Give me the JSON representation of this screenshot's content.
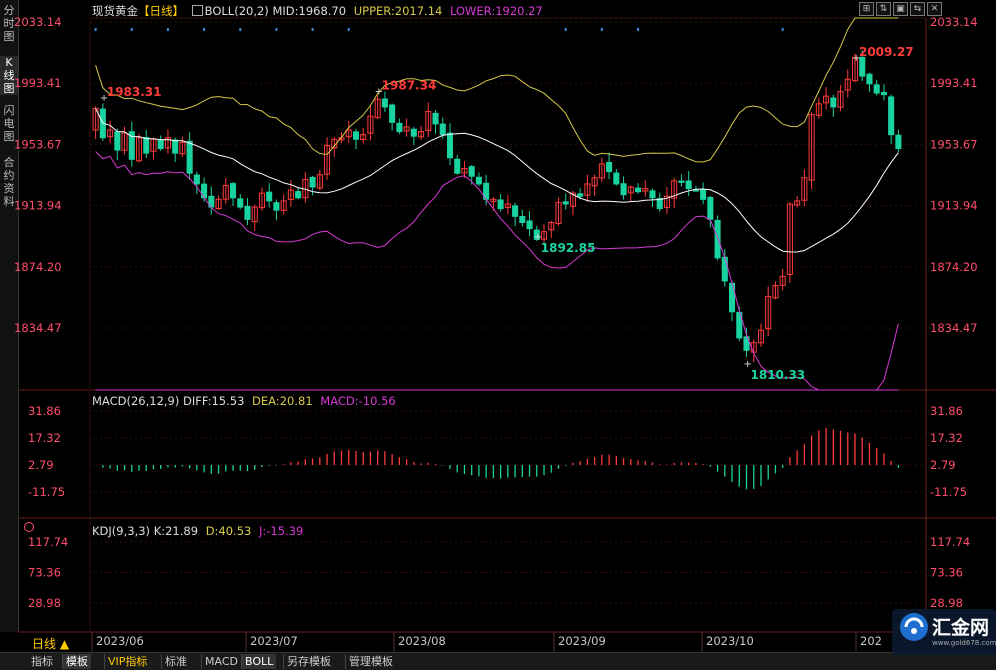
{
  "sidebar": [
    {
      "label": "分时图"
    },
    {
      "label": "K线图"
    },
    {
      "label": "闪电图"
    },
    {
      "label": "合约资料"
    }
  ],
  "header": {
    "instrument": "现货黄金",
    "period": "【日线】",
    "boll_label": "BOLL(20,2)",
    "mid": "MID:1968.70",
    "upper": "UPPER:2017.14",
    "lower": "LOWER:1920.27"
  },
  "macd": {
    "label": "MACD(26,12,9)",
    "diff": "DIFF:15.53",
    "dea": "DEA:20.81",
    "macd": "MACD:-10.56"
  },
  "kdj": {
    "label": "KDJ(9,3,3)",
    "k": "K:21.89",
    "d": "D:40.53",
    "j": "J:-15.39"
  },
  "window_buttons": [
    "⊞",
    "⇅",
    "▣",
    "⇆",
    "✕"
  ],
  "price_axis": [
    "2033.14",
    "1993.41",
    "1953.67",
    "1913.94",
    "1874.20",
    "1834.47"
  ],
  "macd_axis": [
    "31.86",
    "17.32",
    "2.79",
    "-11.75"
  ],
  "kdj_axis": [
    "117.74",
    "73.36",
    "28.98"
  ],
  "date_axis": [
    "2023/06",
    "2023/07",
    "2023/08",
    "2023/09",
    "2023/10",
    "202"
  ],
  "period_button": "日线",
  "annotations": [
    {
      "label": "1983.31"
    },
    {
      "label": "1987.34"
    },
    {
      "label": "1892.85"
    },
    {
      "label": "1810.33"
    },
    {
      "label": "2009.27"
    }
  ],
  "bottom_tabs": [
    "指标",
    "模板",
    "VIP指标",
    "标准",
    "MACD",
    "BOLL",
    "另存模板",
    "管理模板"
  ],
  "logo": {
    "text": "汇金网",
    "url": "www.gold678.com"
  },
  "colors": {
    "up": "#ff3b3b",
    "down": "#19d3a0",
    "mid": "#ffffff",
    "upper": "#d7c94a",
    "lower": "#d63ad6",
    "axis_text": "#ff4d6b"
  },
  "chart_data": [
    {
      "type": "candlestick",
      "title": "现货黄金 日线",
      "x_ticks": [
        "2023/06",
        "2023/07",
        "2023/08",
        "2023/09",
        "2023/10"
      ],
      "ylim": [
        1810,
        2045
      ],
      "close": [
        1977,
        1958,
        1963,
        1950,
        1961,
        1944,
        1958,
        1948,
        1957,
        1951,
        1958,
        1948,
        1955,
        1935,
        1928,
        1919,
        1913,
        1918,
        1927,
        1919,
        1913,
        1905,
        1913,
        1922,
        1917,
        1911,
        1917,
        1924,
        1919,
        1931,
        1926,
        1934,
        1953,
        1957,
        1958,
        1963,
        1957,
        1960,
        1972,
        1983,
        1978,
        1968,
        1962,
        1965,
        1959,
        1962,
        1975,
        1967,
        1960,
        1945,
        1935,
        1938,
        1933,
        1928,
        1918,
        1918,
        1912,
        1915,
        1907,
        1903,
        1899,
        1892,
        1897,
        1903,
        1916,
        1915,
        1922,
        1920,
        1928,
        1932,
        1941,
        1936,
        1928,
        1921,
        1926,
        1923,
        1925,
        1919,
        1912,
        1920,
        1930,
        1929,
        1925,
        1924,
        1918,
        1905,
        1880,
        1865,
        1845,
        1828,
        1820,
        1825,
        1833,
        1855,
        1862,
        1868,
        1915,
        1917,
        1932,
        1973,
        1980,
        1985,
        1978,
        1988,
        1996,
        2010,
        1998,
        1993,
        1987,
        1986,
        1960,
        1951
      ],
      "bollinger": {
        "mid_last": 1968.7,
        "upper_last": 2017.14,
        "lower_last": 1920.27
      }
    },
    {
      "type": "bar",
      "title": "MACD(26,12,9)",
      "ylim": [
        -20,
        33
      ],
      "series": [
        {
          "name": "DIFF",
          "last": 15.53
        },
        {
          "name": "DEA",
          "last": 20.81
        },
        {
          "name": "MACD",
          "last": -10.56
        }
      ]
    },
    {
      "type": "line",
      "title": "KDJ(9,3,3)",
      "ylim": [
        -20,
        125
      ],
      "series": [
        {
          "name": "K",
          "last": 21.89
        },
        {
          "name": "D",
          "last": 40.53
        },
        {
          "name": "J",
          "last": -15.39
        }
      ]
    }
  ]
}
